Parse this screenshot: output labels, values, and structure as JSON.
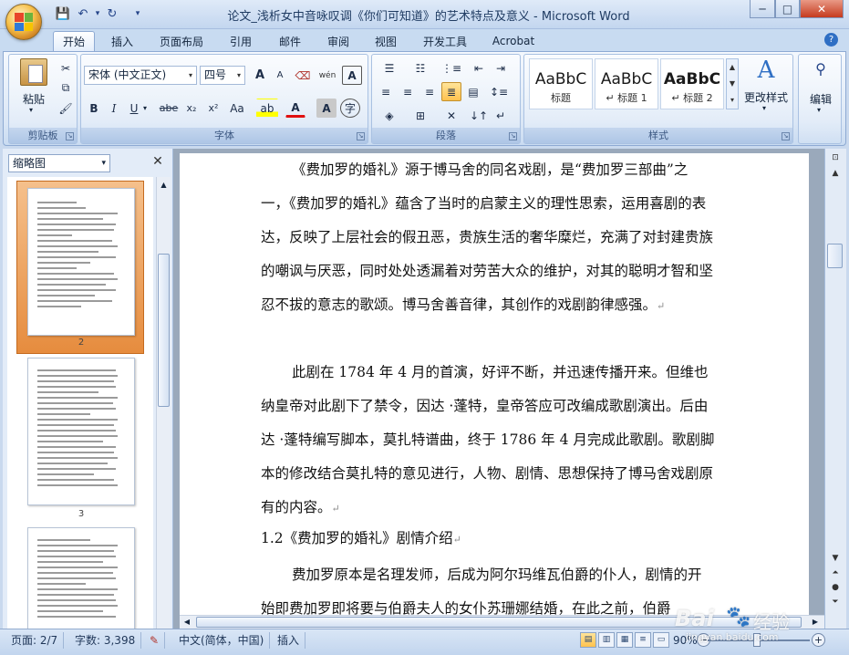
{
  "titlebar": {
    "title": "论文_浅析女中音咏叹调《你们可知道》的艺术特点及意义 - Microsoft Word",
    "qat": [
      "save-icon",
      "undo-icon",
      "redo-icon",
      "customize-icon"
    ],
    "window_buttons": [
      "─",
      "□",
      "✕"
    ]
  },
  "tabs": [
    "开始",
    "插入",
    "页面布局",
    "引用",
    "邮件",
    "审阅",
    "视图",
    "开发工具",
    "Acrobat"
  ],
  "ribbon": {
    "clipboard": {
      "paste": "粘贴",
      "label": "剪贴板"
    },
    "font": {
      "name": "宋体 (中文正文)",
      "size": "四号",
      "label": "字体",
      "row2": [
        "B",
        "I",
        "U",
        "abe",
        "x₂",
        "x²",
        "Aa"
      ],
      "grow": "A",
      "shrink": "A",
      "phonetic": "wén",
      "border_char": "A"
    },
    "paragraph": {
      "label": "段落"
    },
    "styles": {
      "label": "样式",
      "items": [
        {
          "sample": "AaBbC",
          "name": "标题"
        },
        {
          "sample": "AaBbC",
          "name": "↵ 标题 1"
        },
        {
          "sample": "AaBbC",
          "name": "↵ 标题 2"
        }
      ],
      "change": "更改样式"
    },
    "edit": {
      "label": "编辑"
    }
  },
  "nav": {
    "mode": "缩略图",
    "pages": [
      "2",
      "3"
    ]
  },
  "document": {
    "paragraphs": [
      "《费加罗的婚礼》源于博马舍的同名戏剧，是“费加罗三部曲”之一，《费加罗的婚礼》蕴含了当时的启蒙主义的理性思索，运用喜剧的表达，反映了上层社会的假丑恶，贵族生活的奢华糜烂，充满了对封建贵族的嘲讽与厌恶，同时处处透漏着对劳苦大众的维护，对其的聪明才智和坚忍不拔的意志的歌颂。博马舍善音律，其创作的戏剧韵律感强。",
      "此剧在 1784 年 4 月的首演，好评不断，并迅速传播开来。但维也纳皇帝对此剧下了禁令，因达 ·蓬特，皇帝答应可改编成歌剧演出。后由达 ·蓬特编写脚本，莫扎特谱曲，终于 1786 年 4 月完成此歌剧。歌剧脚本的修改结合莫扎特的意见进行，人物、剧情、思想保持了博马舍戏剧原有的内容。"
    ],
    "heading": "1.2《费加罗的婚礼》剧情介绍",
    "para3": "费加罗原本是名理发师，后成为阿尔玛维瓦伯爵的仆人，剧情的开始即费加罗即将要与伯爵夫人的女仆苏珊娜结婚，在此之前，伯爵"
  },
  "status": {
    "page": "页面: 2/7",
    "words": "字数: 3,398",
    "language": "中文(简体，中国)",
    "mode": "插入",
    "zoom": "90%"
  },
  "watermark": {
    "brand": "Bai",
    "brand2": "经验",
    "url": "jingyan.baidu.com"
  }
}
